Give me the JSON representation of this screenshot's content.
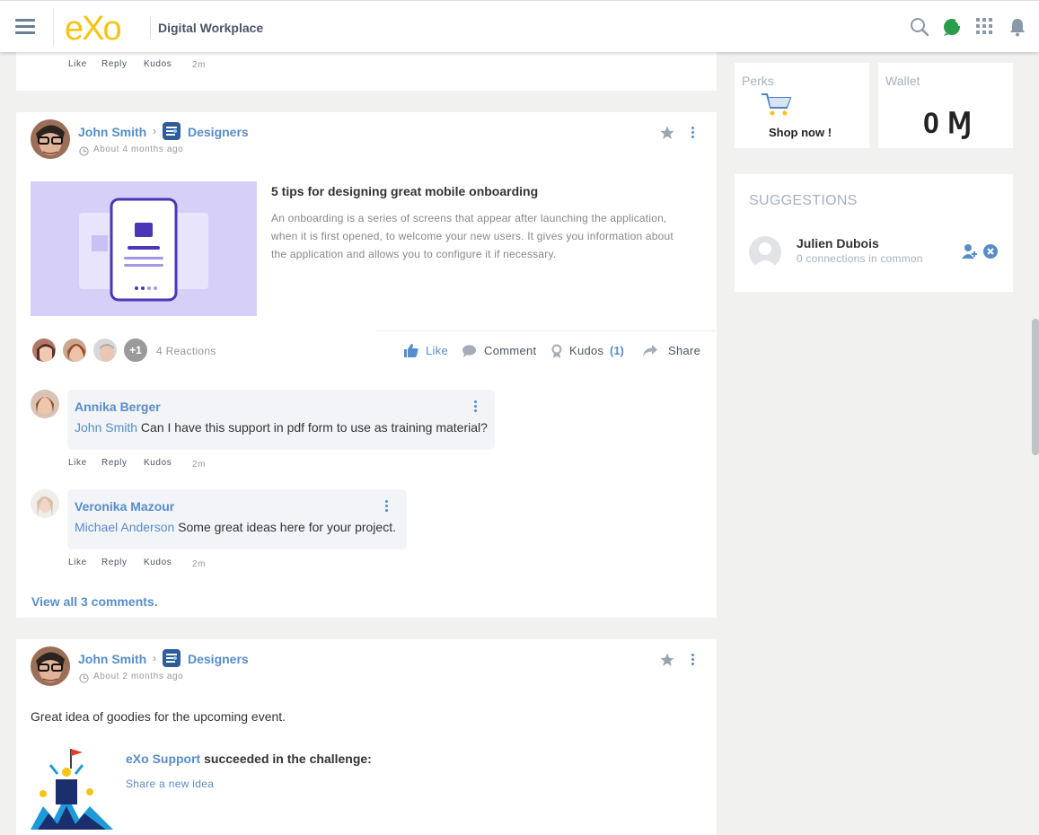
{
  "header": {
    "site_title": "Digital Workplace",
    "logo_text": "eXo"
  },
  "post_prev": {
    "actions": {
      "like": "Like",
      "reply": "Reply",
      "kudos": "Kudos",
      "time": "2m"
    }
  },
  "post1": {
    "author": "John Smith",
    "space": "Designers",
    "time": "About 4 months ago",
    "link_title": "5 tips for designing great mobile onboarding",
    "link_desc_line1": "An onboarding is a series of screens that appear after launching the application,",
    "link_desc_line2": "when it is first opened, to welcome your new users. It gives you information about",
    "link_desc_line3": "the application and allows you to configure it if necessary.",
    "reactions_more": "+1",
    "reactions_count": "4 Reactions",
    "actions": {
      "like": "Like",
      "comment": "Comment",
      "kudos": "Kudos",
      "kudos_count": "(1)",
      "share": "Share"
    },
    "comments": [
      {
        "author": "Annika Berger",
        "mention": "John Smith",
        "text": " Can I have this support in pdf form to use as training material?",
        "like": "Like",
        "reply": "Reply",
        "kudos": "Kudos",
        "time": "2m"
      },
      {
        "author": "Veronika Mazour",
        "mention": "Michael Anderson",
        "text": " Some great ideas here for your project.",
        "like": "Like",
        "reply": "Reply",
        "kudos": "Kudos",
        "time": "2m"
      }
    ],
    "view_all": "View all 3 comments."
  },
  "post2": {
    "author": "John Smith",
    "space": "Designers",
    "time": "About 2 months ago",
    "body": "Great idea of goodies for the upcoming event.",
    "challenge_actor": "eXo Support",
    "challenge_text": " succeeded in the challenge:",
    "challenge_link": "Share a new idea"
  },
  "sidebar": {
    "perks": {
      "title": "Perks",
      "button": "Shop now !"
    },
    "wallet": {
      "title": "Wallet",
      "amount": "0 Ɱ"
    },
    "suggestions": {
      "title": "SUGGESTIONS",
      "name": "Julien Dubois",
      "sub": "0 connections in common"
    }
  },
  "colors": {
    "accent": "#578dc9",
    "logo_yellow": "#f5c414",
    "brand_dark": "#4d5466"
  }
}
